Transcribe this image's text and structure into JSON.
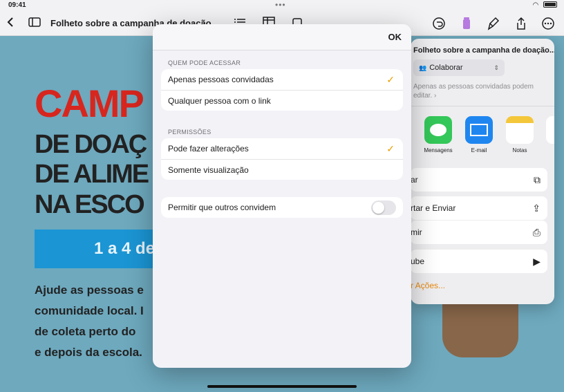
{
  "status_bar": {
    "time": "09:41",
    "battery": ""
  },
  "toolbar": {
    "document_title": "Folheto sobre a campanha de doação"
  },
  "document": {
    "headline": "CAMP",
    "line2": "DE DOAÇ",
    "line3": "DE ALIME",
    "line4": "NA ESCO",
    "date_band": "1 a 4 de",
    "body_lines": [
      "Ajude as pessoas e",
      "comunidade local. I",
      "de coleta perto do",
      "e depois da escola."
    ]
  },
  "share_sheet": {
    "title": "Folheto sobre a campanha de doação...",
    "collab_label": "Colaborar",
    "description": "Apenas as pessoas convidadas podem editar.",
    "apps": [
      {
        "label": "Mensagens",
        "icon": "messages-icon"
      },
      {
        "label": "E-mail",
        "icon": "mail-icon"
      },
      {
        "label": "Notas",
        "icon": "notes-icon"
      },
      {
        "label": "Le",
        "icon": "reminders-icon"
      }
    ],
    "rows": [
      {
        "label": "ar",
        "icon": "copy-icon"
      },
      {
        "label": "rtar e Enviar",
        "icon": "export-icon"
      },
      {
        "label": "mir",
        "icon": "printer-icon"
      },
      {
        "label": "ube",
        "icon": "youtube-icon"
      }
    ],
    "more_actions": "r Ações..."
  },
  "modal": {
    "ok_label": "OK",
    "access_section": "QUEM PODE ACESSAR",
    "access_options": [
      {
        "label": "Apenas pessoas convidadas",
        "selected": true
      },
      {
        "label": "Qualquer pessoa com o link",
        "selected": false
      }
    ],
    "permissions_section": "PERMISSÕES",
    "permission_options": [
      {
        "label": "Pode fazer alterações",
        "selected": true
      },
      {
        "label": "Somente visualização",
        "selected": false
      }
    ],
    "allow_invite_label": "Permitir que outros convidem",
    "allow_invite_on": false
  },
  "colors": {
    "accent": "#e8a000",
    "headline_red": "#d7261e",
    "band_blue": "#1b95d4"
  }
}
